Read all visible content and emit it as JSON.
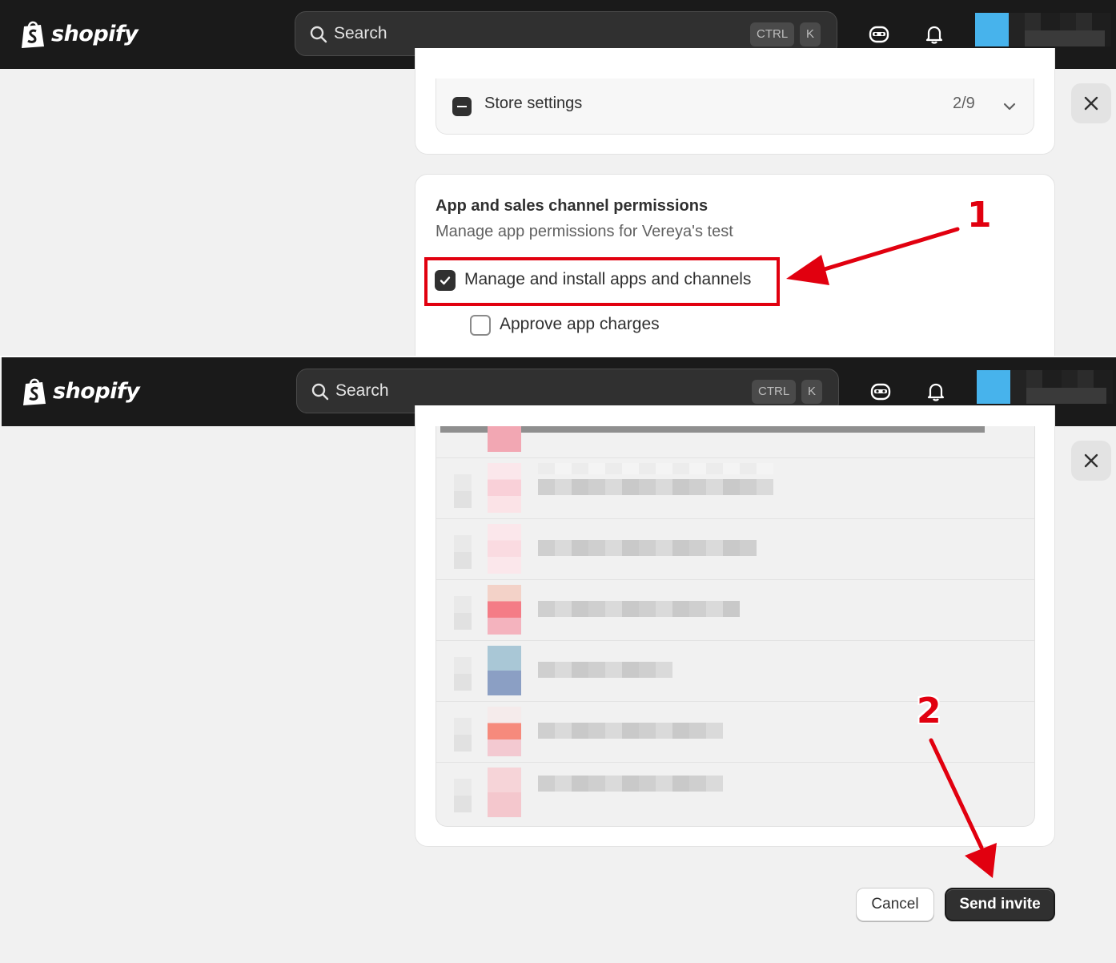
{
  "topbar": {
    "brand": "shopify",
    "search_placeholder": "Search",
    "shortcut_modifier": "CTRL",
    "shortcut_key": "K",
    "icons": [
      "search-icon",
      "sidekick-icon",
      "bell-icon",
      "avatar"
    ]
  },
  "step1": {
    "store_settings": {
      "label": "Store settings",
      "count": "2/9"
    },
    "section_title": "App and sales channel permissions",
    "section_subtitle": "Manage app permissions for Vereya's test",
    "permissions": [
      {
        "label": "Manage and install apps and channels",
        "checked": true
      },
      {
        "label": "Approve app charges",
        "checked": false
      }
    ],
    "annotation": "1"
  },
  "step2": {
    "cancel_label": "Cancel",
    "send_label": "Send invite",
    "annotation": "2"
  },
  "colors": {
    "topbar": "#1a1a1a",
    "annotation_red": "#e1000f",
    "primary_button": "#303030",
    "avatar": "#47b3ec"
  }
}
